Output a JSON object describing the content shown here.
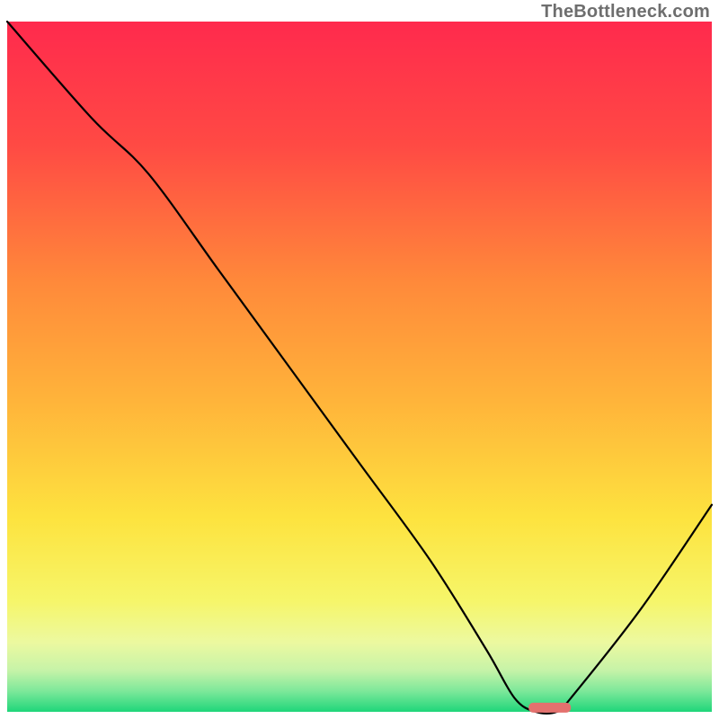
{
  "watermark": "TheBottleneck.com",
  "chart_data": {
    "type": "line",
    "title": "",
    "xlabel": "",
    "ylabel": "",
    "xlim": [
      0,
      100
    ],
    "ylim": [
      0,
      100
    ],
    "annotations": [],
    "series": [
      {
        "name": "bottleneck-curve",
        "x": [
          0,
          12,
          20,
          30,
          40,
          50,
          60,
          68,
          72,
          75,
          78,
          80,
          90,
          100
        ],
        "y": [
          100,
          86,
          78,
          64,
          50,
          36,
          22,
          9,
          2,
          0,
          0,
          2,
          15,
          30
        ],
        "color": "#000000"
      }
    ],
    "marker": {
      "name": "optimal-marker",
      "x_start": 74,
      "x_end": 80,
      "y": 0.6,
      "color": "#e4716e"
    },
    "background_gradient": {
      "stops": [
        {
          "offset": 0.0,
          "color": "#ff2a4d"
        },
        {
          "offset": 0.18,
          "color": "#ff4a44"
        },
        {
          "offset": 0.38,
          "color": "#ff8a3a"
        },
        {
          "offset": 0.55,
          "color": "#ffb43a"
        },
        {
          "offset": 0.72,
          "color": "#fde33f"
        },
        {
          "offset": 0.84,
          "color": "#f6f66a"
        },
        {
          "offset": 0.9,
          "color": "#ecf9a0"
        },
        {
          "offset": 0.94,
          "color": "#c6f3a8"
        },
        {
          "offset": 0.97,
          "color": "#7de89a"
        },
        {
          "offset": 1.0,
          "color": "#1fd67a"
        }
      ]
    }
  }
}
